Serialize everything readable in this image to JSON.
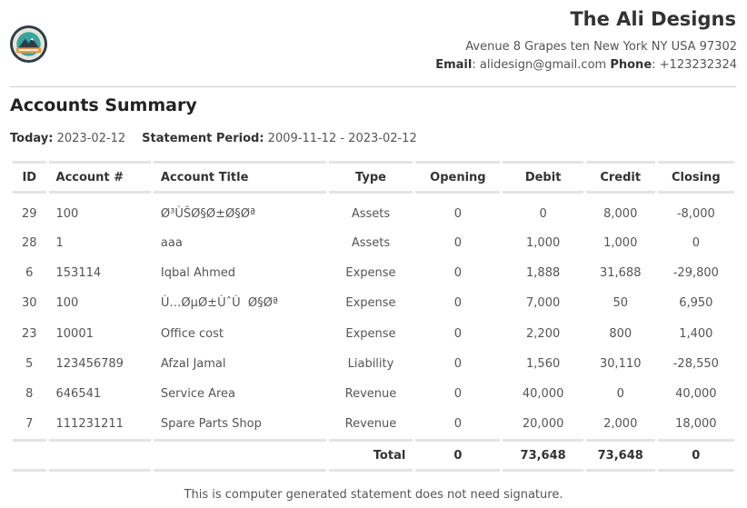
{
  "header": {
    "company_name": "The Ali Designs",
    "address": "Avenue 8 Grapes ten New York NY USA 97302",
    "email_label": "Email",
    "email": "alidesign@gmail.com",
    "phone_label": "Phone",
    "phone": "+123232324",
    "logo_icon": "company-logo-badge"
  },
  "report": {
    "title": "Accounts Summary",
    "today_label": "Today:",
    "today": "2023-02-12",
    "period_label": "Statement Period:",
    "period": "2009-11-12 - 2023-02-12"
  },
  "table": {
    "columns": [
      "ID",
      "Account #",
      "Account Title",
      "Type",
      "Opening",
      "Debit",
      "Credit",
      "Closing"
    ],
    "rows": [
      [
        "29",
        "100",
        "Ø³ÙŠØ§Ø±Ø§Øª",
        "Assets",
        "0",
        "0",
        "8,000",
        "-8,000"
      ],
      [
        "28",
        "1",
        "aaa",
        "Assets",
        "0",
        "1,000",
        "1,000",
        "0"
      ],
      [
        "6",
        "153114",
        "Iqbal Ahmed",
        "Expense",
        "0",
        "1,888",
        "31,688",
        "-29,800"
      ],
      [
        "30",
        "100",
        "Ù…ØµØ±ÙˆÙ  Ø§Øª",
        "Expense",
        "0",
        "7,000",
        "50",
        "6,950"
      ],
      [
        "23",
        "10001",
        "Office cost",
        "Expense",
        "0",
        "2,200",
        "800",
        "1,400"
      ],
      [
        "5",
        "123456789",
        "Afzal Jamal",
        "Liability",
        "0",
        "1,560",
        "30,110",
        "-28,550"
      ],
      [
        "8",
        "646541",
        "Service Area",
        "Revenue",
        "0",
        "40,000",
        "0",
        "40,000"
      ],
      [
        "7",
        "111231211",
        "Spare Parts Shop",
        "Revenue",
        "0",
        "20,000",
        "2,000",
        "18,000"
      ]
    ],
    "total": {
      "label": "Total",
      "opening": "0",
      "debit": "73,648",
      "credit": "73,648",
      "closing": "0"
    }
  },
  "footer": {
    "note": "This is computer generated statement does not need signature."
  },
  "colors": {
    "logo_teal": "#3aa5a0",
    "logo_orange": "#e89a4c",
    "logo_dark": "#2f3d4a",
    "rule": "#e4e4e4"
  }
}
